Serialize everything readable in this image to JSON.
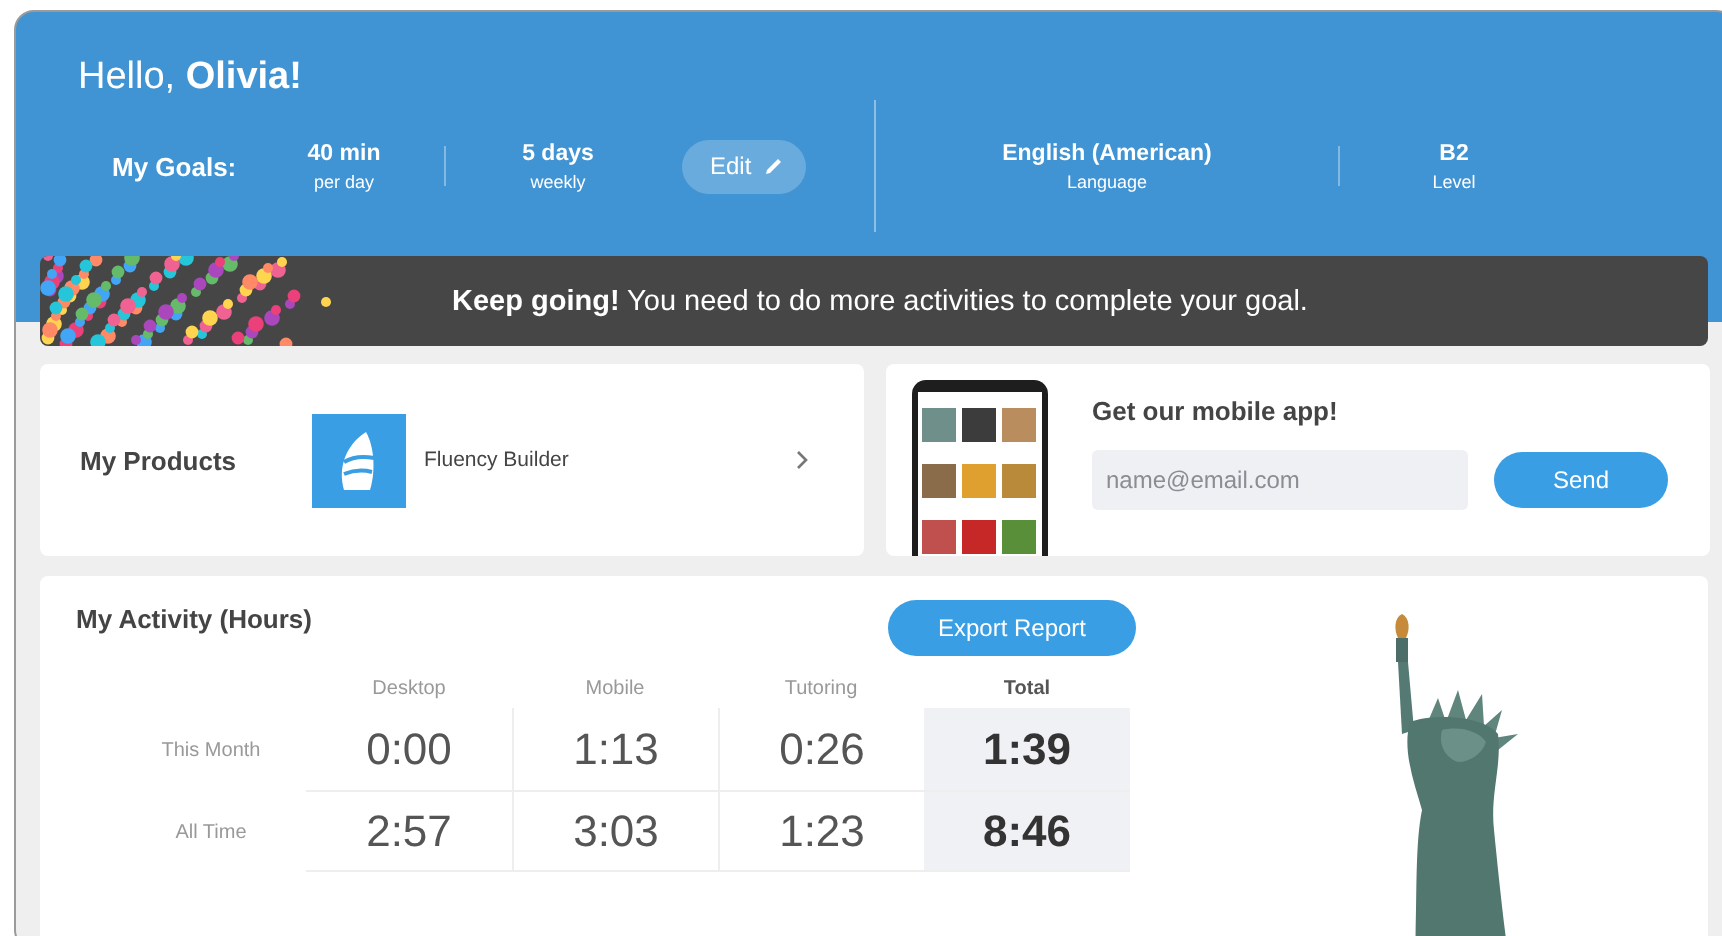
{
  "header": {
    "greeting": "Hello, **Olivia!**",
    "goals_label": "My Goals:",
    "goals": [
      {
        "value": "40 min",
        "caption": "per day"
      },
      {
        "value": "5 days",
        "caption": "weekly"
      }
    ],
    "edit_button": "Edit",
    "stats": [
      {
        "value": "English (American)",
        "caption": "Language"
      },
      {
        "value": "B2",
        "caption": "Level"
      }
    ]
  },
  "banner": {
    "message": "**Keep going!** You need to do more activities to complete your goal."
  },
  "products": {
    "title": "My Products",
    "items": [
      {
        "name": "Fluency Builder"
      }
    ]
  },
  "mobile_app": {
    "title": "Get our mobile app!",
    "email": {
      "placeholder": "name@email.com"
    },
    "send_button": "Send"
  },
  "activity": {
    "title": "My Activity (Hours)",
    "export_button": "Export Report",
    "columns": [
      "Desktop",
      "Mobile",
      "Tutoring",
      "Total"
    ],
    "rows": [
      {
        "label": "This Month",
        "cells": [
          "0:00",
          "1:13",
          "0:26",
          "1:39"
        ]
      },
      {
        "label": "All Time",
        "cells": [
          "2:57",
          "3:03",
          "1:23",
          "8:46"
        ]
      }
    ]
  }
}
